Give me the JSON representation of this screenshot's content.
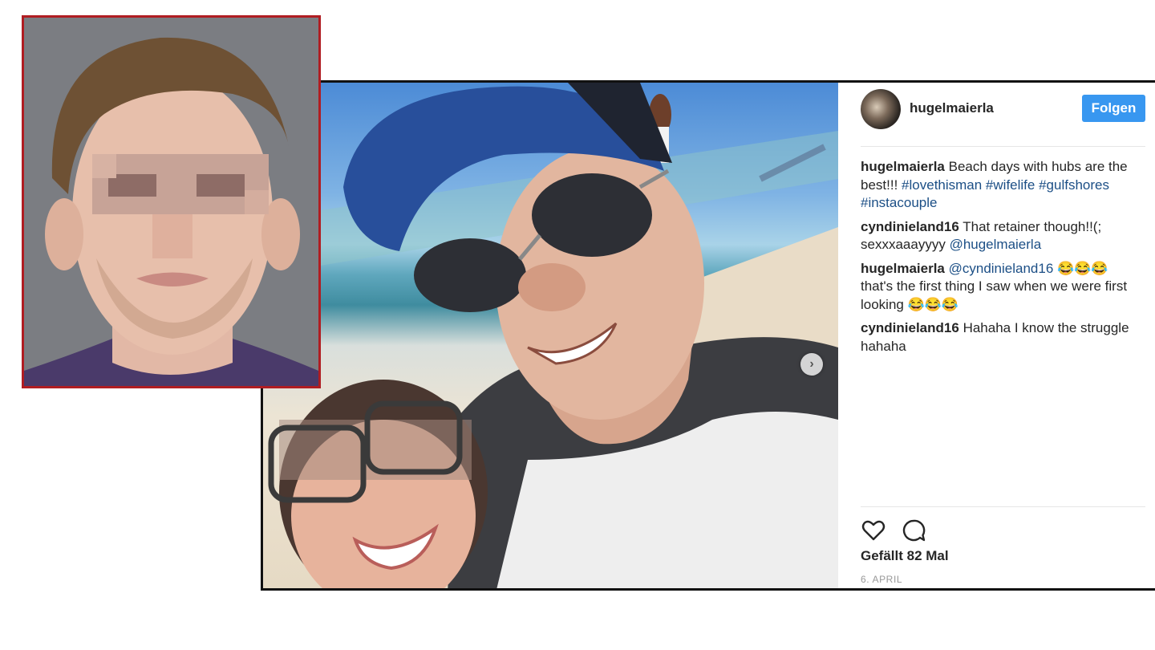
{
  "post": {
    "username": "hugelmaierla",
    "follow_label": "Folgen",
    "caption": {
      "author": "hugelmaierla",
      "text": "Beach days with hubs are the best!!!",
      "hashtags": "#lovethisman #wifelife #gulfshores #instacouple"
    },
    "comments": [
      {
        "author": "cyndinieland16",
        "text": "That retainer though!!(; sexxxaaayyyy",
        "mention": "@hugelmaierla",
        "after": ""
      },
      {
        "author": "hugelmaierla",
        "text": "",
        "mention": "@cyndinieland16",
        "after": "😂😂😂 that's the first thing I saw when we were first looking 😂😂😂"
      },
      {
        "author": "cyndinieland16",
        "text": "Hahaha I know the struggle hahaha",
        "mention": "",
        "after": ""
      }
    ],
    "likes_label": "Gefällt 82 Mal",
    "date_label": "6. APRIL"
  },
  "icons": {
    "like": "heart-outline-icon",
    "comment": "speech-bubble-icon",
    "next": "chevron-right-icon"
  },
  "colors": {
    "follow_button": "#3897f0",
    "hashtag": "#1c4f86",
    "mugshot_border": "#b01d22"
  }
}
